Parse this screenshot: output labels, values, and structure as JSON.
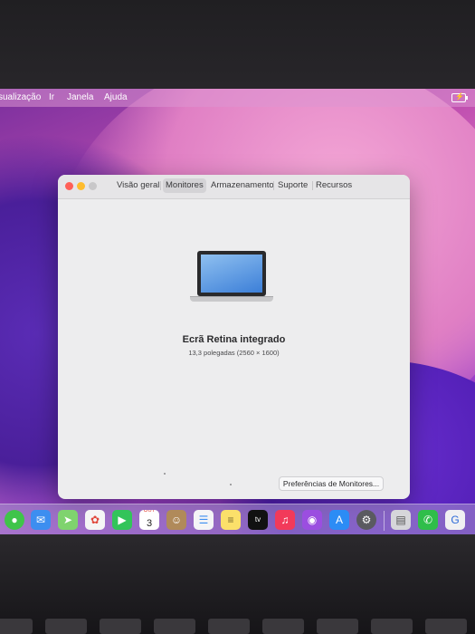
{
  "menubar": {
    "items": [
      "sualização",
      "Ir",
      "Janela",
      "Ajuda"
    ]
  },
  "window": {
    "tabs": [
      {
        "label": "Visão geral",
        "active": false
      },
      {
        "label": "Monitores",
        "active": true
      },
      {
        "label": "Armazenamento",
        "active": false
      },
      {
        "label": "Suporte",
        "active": false
      },
      {
        "label": "Recursos",
        "active": false
      }
    ],
    "display_name": "Ecrã Retina integrado",
    "display_spec": "13,3 polegadas (2560 × 1600)",
    "prefs_button": "Preferências de Monitores..."
  },
  "dock": {
    "calendar_month": "OUT",
    "calendar_day": "3",
    "icons": [
      "messages-icon",
      "mail-icon",
      "maps-icon",
      "photos-icon",
      "facetime-icon",
      "calendar-icon",
      "contacts-icon",
      "reminders-icon",
      "notes-icon",
      "appletv-icon",
      "music-icon",
      "podcasts-icon",
      "appstore-icon",
      "system-preferences-icon",
      "preview-icon",
      "whatsapp-icon",
      "extra-app-icon"
    ]
  },
  "colors": {
    "close": "#ff5f57",
    "minimize": "#febc2e",
    "maximize": "#c8c7c9"
  }
}
